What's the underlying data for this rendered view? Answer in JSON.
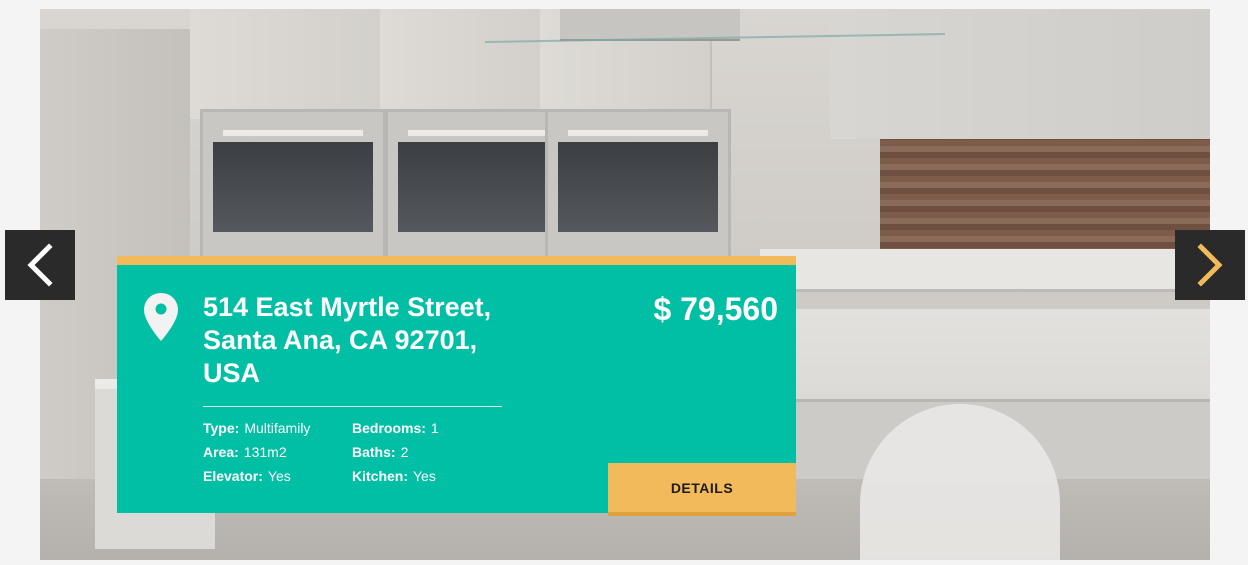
{
  "listing": {
    "address_line1": "514 East Myrtle Street,",
    "address_line2": "Santa Ana, CA 92701,",
    "address_line3": "USA",
    "price": "$ 79,560",
    "details_label": "DETAILS",
    "specs": [
      {
        "key": "Type:",
        "value": "Multifamily"
      },
      {
        "key": "Bedrooms:",
        "value": "1"
      },
      {
        "key": "Area:",
        "value": "131m2"
      },
      {
        "key": "Baths:",
        "value": "2"
      },
      {
        "key": "Elevator:",
        "value": "Yes"
      },
      {
        "key": "Kitchen:",
        "value": "Yes"
      }
    ]
  },
  "icons": {
    "prev": "chevron-left-icon",
    "next": "chevron-right-icon",
    "location": "map-pin-icon"
  },
  "colors": {
    "card_background": "#00bfa5",
    "accent": "#f3ba5c",
    "arrow_background": "#2a2a2a",
    "next_arrow": "#f3ba5c"
  }
}
